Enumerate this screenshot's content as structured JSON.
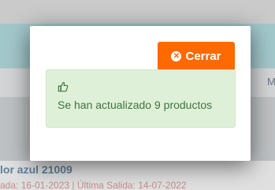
{
  "background": {
    "row_right_text": "M",
    "item_title": "lor azul 21009",
    "item_subtitle": "ada: 16-01-2023 | Última Salida: 14-07-2022"
  },
  "modal": {
    "close_label": "Cerrar",
    "alert": {
      "icon": "thumbs-up-icon",
      "message": "Se han actualizado 9 productos"
    }
  },
  "colors": {
    "accent": "#ff6a00",
    "alert_bg": "#dff0d8",
    "alert_text": "#3c763d"
  }
}
